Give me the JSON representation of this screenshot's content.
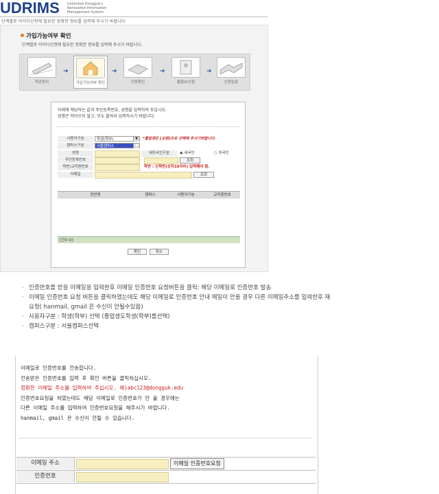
{
  "header": {
    "logo": "UDRIMS",
    "logo_sub": "Unlimited Dongguk's Renovated Information Management System",
    "top_note": "단계별로 아이디신청에 필요한 정확한 정보를 입력해 주시기 바랍니다"
  },
  "section": {
    "title": "가입가능여부 확인",
    "subtitle": "단계별로 아이디신청에 필요한 정확한 정보를 입력해 주시기 바랍니다."
  },
  "steps": [
    {
      "label": "약관동의"
    },
    {
      "label": "가입가능여부 확인"
    },
    {
      "label": "인증확인"
    },
    {
      "label": "통합ID신청"
    },
    {
      "label": "신청완료"
    }
  ],
  "form": {
    "intro_line1": "아래에 해당하는 값과 주민등록번호, 성명을 입력하여 주십시오.",
    "intro_line2": "성명은 띄어쓰지 말고, 모두 붙여서 입력하시기 바랍니다.",
    "labels": {
      "user_type": "사용자구분",
      "campus": "캠퍼스구분",
      "name": "성명",
      "rrn": "주민등록번호",
      "student_id": "학번/교직원번호",
      "email": "이메일",
      "nationality": "내외국인구분"
    },
    "user_type_value": "학생(학부)",
    "user_type_note": "*졸업생은 [교원]으로 선택해 주시기바랍니다.",
    "campus_value": "서울캠퍼스",
    "nationality_options": [
      "내국인",
      "외국인"
    ],
    "rrn_sep": "-",
    "search_label": "조회",
    "student_id_note": "학번 : 신학번(숫자10자리) 입력해야 함.",
    "table_headers": [
      "정찬명",
      "캠퍼스",
      "사용자구분",
      "교직원번호"
    ],
    "count_text": "[건수:0]",
    "ok_label": "확인",
    "cancel_label": "취소"
  },
  "bullets": [
    "인증번호를 받을 이메일을 입력한후 이메일 인증번호 요청버튼을 클릭: 해당 이메일로 인증번호 발송",
    "이메일 인증번호 요청 버튼을 클릭하였는데도 해당 이메일로 인증번호 안내 메일이 안올 경우 다른 이메일주소를 입력한후 재",
    "요청( hanmail, gmail 은 수신이 안될수있음)",
    "사용자구분 : 학생(학부) 선택 (졸업생도학생(학부)를선택)",
    "캠퍼스구분 : 서울캠퍼스선택"
  ],
  "email_section": {
    "line1": "이메일로 인증번호를 전송합니다.",
    "line2": "전송받은 인증번호를 입력 후 확인 버튼을 클릭하십시오.",
    "line3": "정확한 이메일 주소를 입력하여 주십시오. 예)abc123@dongguk.edu",
    "line4": "인증번호요청을 하였는데도 해당 이메일로 인증번호가 안 올 경우에는",
    "line5": "다른 이메일 주소를 입력하여 인증번호요청을 해주시기 바랍니다.",
    "line6": "hanmail, gmail 은 수신이 안될 수 있습니다.",
    "email_label": "이메일 주소",
    "request_button": "이메일 인증번호요청",
    "code_label": "인증번호"
  }
}
